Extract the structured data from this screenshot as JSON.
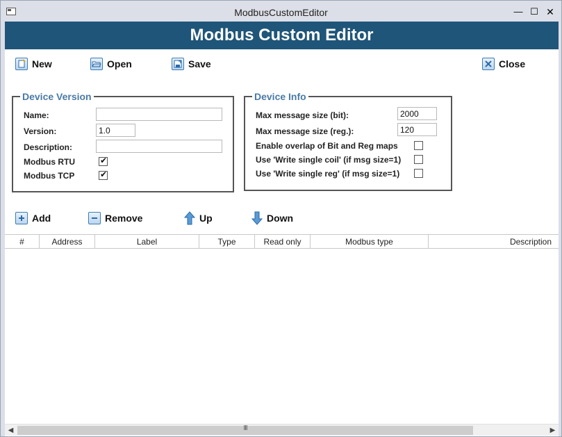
{
  "window": {
    "title": "ModbusCustomEditor",
    "minimize": "—",
    "maximize": "☐",
    "close": "✕"
  },
  "header": {
    "title": "Modbus Custom Editor"
  },
  "toolbar": {
    "new_label": "New",
    "open_label": "Open",
    "save_label": "Save",
    "close_label": "Close"
  },
  "device_version": {
    "legend": "Device Version",
    "name_label": "Name:",
    "name_value": "",
    "version_label": "Version:",
    "version_value": "1.0",
    "description_label": "Description:",
    "description_value": "",
    "rtu_label": "Modbus RTU",
    "rtu_checked": true,
    "tcp_label": "Modbus TCP",
    "tcp_checked": true
  },
  "device_info": {
    "legend": "Device Info",
    "max_bit_label": "Max message size (bit):",
    "max_bit_value": "2000",
    "max_reg_label": "Max message size (reg.):",
    "max_reg_value": "120",
    "overlap_label": "Enable overlap of Bit and Reg maps",
    "overlap_checked": false,
    "single_coil_label": "Use 'Write single coil' (if msg size=1)",
    "single_coil_checked": false,
    "single_reg_label": "Use 'Write single reg' (if msg size=1)",
    "single_reg_checked": false
  },
  "row_toolbar": {
    "add_label": "Add",
    "remove_label": "Remove",
    "up_label": "Up",
    "down_label": "Down"
  },
  "table": {
    "columns": [
      "#",
      "Address",
      "Label",
      "Type",
      "Read only",
      "Modbus type",
      "Description"
    ],
    "rows": []
  },
  "scrollbar": {
    "left_arrow": "◀",
    "right_arrow": "▶",
    "grip": "III"
  },
  "colors": {
    "banner": "#1f5578",
    "legend": "#4a7aa6",
    "icon_blue": "#3a7bb5"
  }
}
